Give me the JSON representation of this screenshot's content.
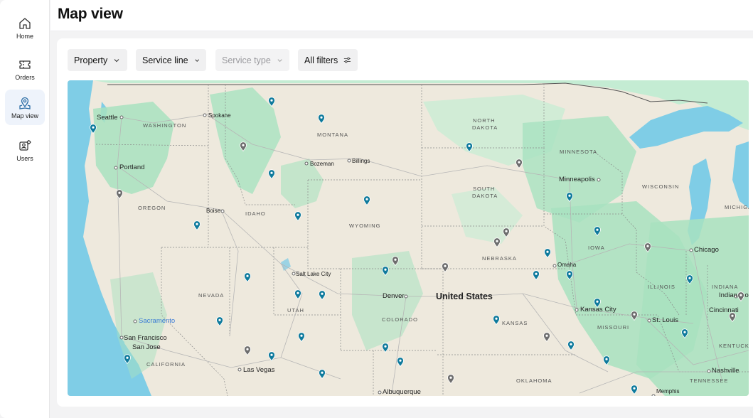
{
  "nav": {
    "items": [
      {
        "label": "Home",
        "icon": "home-icon"
      },
      {
        "label": "Orders",
        "icon": "ticket-icon"
      },
      {
        "label": "Map view",
        "icon": "map-pin-icon"
      },
      {
        "label": "Users",
        "icon": "users-gear-icon"
      }
    ],
    "active_index": 2
  },
  "header": {
    "title": "Map view"
  },
  "filters": {
    "property": "Property",
    "service_line": "Service line",
    "service_type": "Service type",
    "all_filters": "All filters"
  },
  "map": {
    "country": "United States",
    "cities": {
      "seattle": "Seattle",
      "spokane": "Spokane",
      "portland": "Portland",
      "boise": "Boise",
      "bozeman": "Bozeman",
      "billings": "Billings",
      "salt_lake_city": "Salt Lake City",
      "sacramento": "Sacramento",
      "san_francisco": "San Francisco",
      "san_jose": "San Jose",
      "las_vegas": "Las Vegas",
      "denver": "Denver",
      "albuquerque": "Albuquerque",
      "minneapolis": "Minneapolis",
      "omaha": "Omaha",
      "chicago": "Chicago",
      "kansas_city": "Kansas City",
      "st_louis": "St. Louis",
      "indianapolis": "Indianapo",
      "cincinnati": "Cincinnati",
      "nashville": "Nashville",
      "memphis": "Memphis"
    },
    "states": {
      "washington": "WASHINGTON",
      "oregon": "OREGON",
      "idaho": "IDAHO",
      "montana": "MONTANA",
      "wyoming": "WYOMING",
      "nevada": "NEVADA",
      "utah": "UTAH",
      "colorado": "COLORADO",
      "california": "CALIFORNIA",
      "north_dakota_1": "NORTH",
      "north_dakota_2": "DAKOTA",
      "south_dakota_1": "SOUTH",
      "south_dakota_2": "DAKOTA",
      "nebraska": "NEBRASKA",
      "kansas": "KANSAS",
      "minnesota": "MINNESOTA",
      "iowa": "IOWA",
      "wisconsin": "WISCONSIN",
      "illinois": "ILLINOIS",
      "missouri": "MISSOURI",
      "indiana": "INDIANA",
      "michigan": "MICHIGA",
      "kentucky": "KENTUCKY",
      "tennessee": "TENNESSEE",
      "oklahoma": "OKLAHOMA"
    },
    "colors": {
      "active_pin": "#0e7a9c",
      "inactive_pin": "#6d6d6d",
      "water": "#7fcde6",
      "land": "#eee9dd",
      "forest": "#a8e2c0"
    }
  }
}
